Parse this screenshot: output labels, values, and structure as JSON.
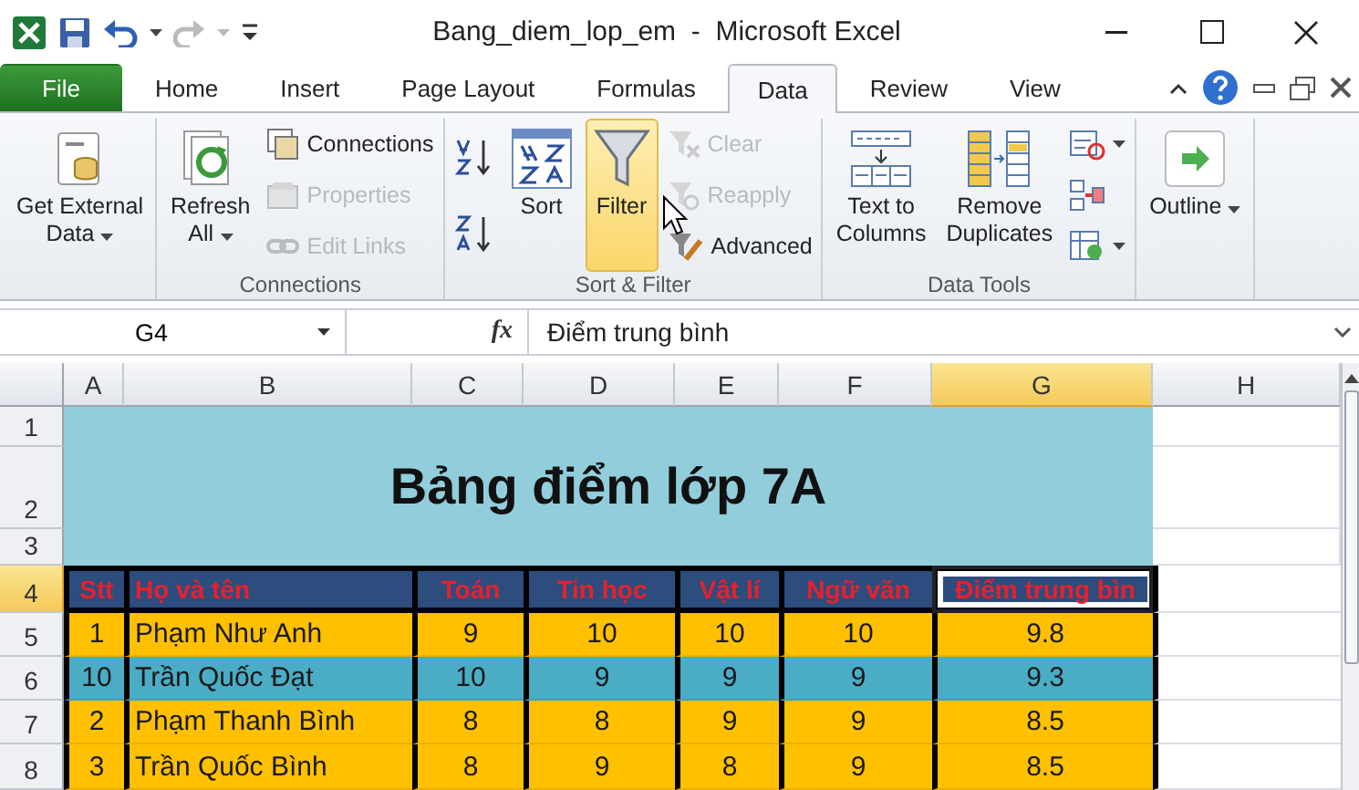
{
  "window": {
    "title": "Bang_diem_lop_em  -  Microsoft Excel"
  },
  "tabs": [
    {
      "label": "File",
      "kind": "file",
      "selected": false
    },
    {
      "label": "Home",
      "kind": "tab",
      "selected": false
    },
    {
      "label": "Insert",
      "kind": "tab",
      "selected": false
    },
    {
      "label": "Page Layout",
      "kind": "tab",
      "selected": false
    },
    {
      "label": "Formulas",
      "kind": "tab",
      "selected": false
    },
    {
      "label": "Data",
      "kind": "tab",
      "selected": true
    },
    {
      "label": "Review",
      "kind": "tab",
      "selected": false
    },
    {
      "label": "View",
      "kind": "tab",
      "selected": false
    }
  ],
  "ribbon": [
    {
      "items": [
        {
          "kind": "large",
          "lines": [
            "Get External",
            "Data"
          ],
          "dropdown": true,
          "disabled": false,
          "selected": false
        }
      ]
    },
    {
      "label": "Connections",
      "items": [
        {
          "kind": "large",
          "lines": [
            "Refresh",
            "All"
          ],
          "dropdown": true,
          "disabled": false,
          "selected": false
        },
        {
          "kind": "small",
          "lines": [
            "Connections"
          ],
          "dropdown": false,
          "disabled": false,
          "selected": false
        },
        {
          "kind": "small",
          "lines": [
            "Properties"
          ],
          "dropdown": false,
          "disabled": true,
          "selected": false
        },
        {
          "kind": "small",
          "lines": [
            "Edit Links"
          ],
          "dropdown": false,
          "disabled": true,
          "selected": false
        }
      ]
    },
    {
      "label": "Sort & Filter",
      "items": [
        {
          "kind": "icon",
          "dropdown": false,
          "disabled": false,
          "selected": false
        },
        {
          "kind": "icon",
          "dropdown": false,
          "disabled": false,
          "selected": false
        },
        {
          "kind": "large",
          "lines": [
            "Sort"
          ],
          "dropdown": false,
          "disabled": false,
          "selected": false
        },
        {
          "kind": "large",
          "lines": [
            "Filter"
          ],
          "dropdown": false,
          "disabled": false,
          "selected": true
        },
        {
          "kind": "small",
          "lines": [
            "Clear"
          ],
          "dropdown": false,
          "disabled": true,
          "selected": false
        },
        {
          "kind": "small",
          "lines": [
            "Reapply"
          ],
          "dropdown": false,
          "disabled": true,
          "selected": false
        },
        {
          "kind": "small",
          "lines": [
            "Advanced"
          ],
          "dropdown": false,
          "disabled": false,
          "selected": false
        }
      ]
    },
    {
      "label": "Data Tools",
      "items": [
        {
          "kind": "large",
          "lines": [
            "Text to",
            "Columns"
          ],
          "dropdown": false,
          "disabled": false,
          "selected": false
        },
        {
          "kind": "large",
          "lines": [
            "Remove",
            "Duplicates"
          ],
          "dropdown": false,
          "disabled": false,
          "selected": false
        },
        {
          "kind": "icon",
          "dropdown": true,
          "disabled": false,
          "selected": false
        },
        {
          "kind": "icon",
          "dropdown": false,
          "disabled": false,
          "selected": false
        },
        {
          "kind": "icon",
          "dropdown": true,
          "disabled": false,
          "selected": false
        }
      ]
    },
    {
      "items": [
        {
          "kind": "large",
          "lines": [
            "Outline"
          ],
          "dropdown": true,
          "disabled": false,
          "selected": false
        }
      ]
    }
  ],
  "formula_bar": {
    "name_box": "G4",
    "function_label": "fx",
    "value": "Điểm trung bình"
  },
  "sheet": {
    "columns": [
      {
        "label": "A",
        "selected": false
      },
      {
        "label": "B",
        "selected": false
      },
      {
        "label": "C",
        "selected": false
      },
      {
        "label": "D",
        "selected": false
      },
      {
        "label": "E",
        "selected": false
      },
      {
        "label": "F",
        "selected": false
      },
      {
        "label": "G",
        "selected": true
      },
      {
        "label": "H",
        "selected": false
      }
    ],
    "title_rows": [
      {
        "row": "1",
        "selected": false
      },
      {
        "row": "2",
        "selected": false
      },
      {
        "row": "3",
        "selected": false
      }
    ],
    "title": "Bảng điểm lớp 7A",
    "header": {
      "row": "4",
      "selected": true,
      "cells": [
        "Stt",
        "Họ và tên",
        "Toán",
        "Tin học",
        "Vật lí",
        "Ngữ văn",
        "Điểm trung bìn"
      ]
    },
    "rows": [
      {
        "row": "5",
        "selected": false,
        "color": "#ffc000",
        "cells": [
          "1",
          "Phạm Như Anh",
          "9",
          "10",
          "10",
          "10",
          "9.8"
        ]
      },
      {
        "row": "6",
        "selected": false,
        "color": "#4bacc6",
        "cells": [
          "10",
          "Trần Quốc Đạt",
          "10",
          "9",
          "9",
          "9",
          "9.3"
        ]
      },
      {
        "row": "7",
        "selected": false,
        "color": "#ffc000",
        "cells": [
          "2",
          "Phạm Thanh Bình",
          "8",
          "8",
          "9",
          "9",
          "8.5"
        ]
      },
      {
        "row": "8",
        "selected": false,
        "color": "#ffc000",
        "cells": [
          "3",
          "Trần Quốc Bình",
          "8",
          "9",
          "8",
          "9",
          "8.5"
        ]
      }
    ]
  }
}
